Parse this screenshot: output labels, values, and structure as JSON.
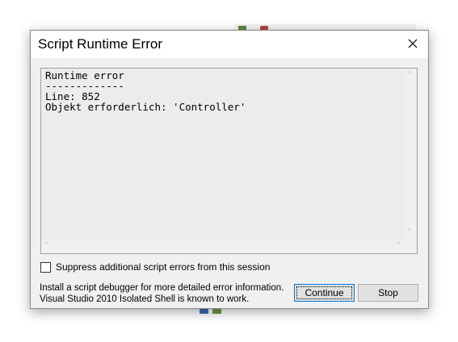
{
  "dialog": {
    "title": "Script Runtime Error",
    "close_icon": "close-icon"
  },
  "error_text": {
    "lines": [
      "Runtime error",
      "-------------",
      "Line: 852",
      "Objekt erforderlich: 'Controller'"
    ]
  },
  "checkbox": {
    "label": "Suppress additional script errors from this session",
    "checked": false
  },
  "info": {
    "line1": "Install a script debugger for more detailed error information.",
    "line2": "Visual Studio 2010 Isolated Shell is known to work."
  },
  "buttons": {
    "continue_label": "Continue",
    "stop_label": "Stop"
  },
  "colors": {
    "dialog_bg": "#f0f0f0",
    "titlebar_bg": "#ffffff",
    "focus_border": "#0078d7"
  }
}
